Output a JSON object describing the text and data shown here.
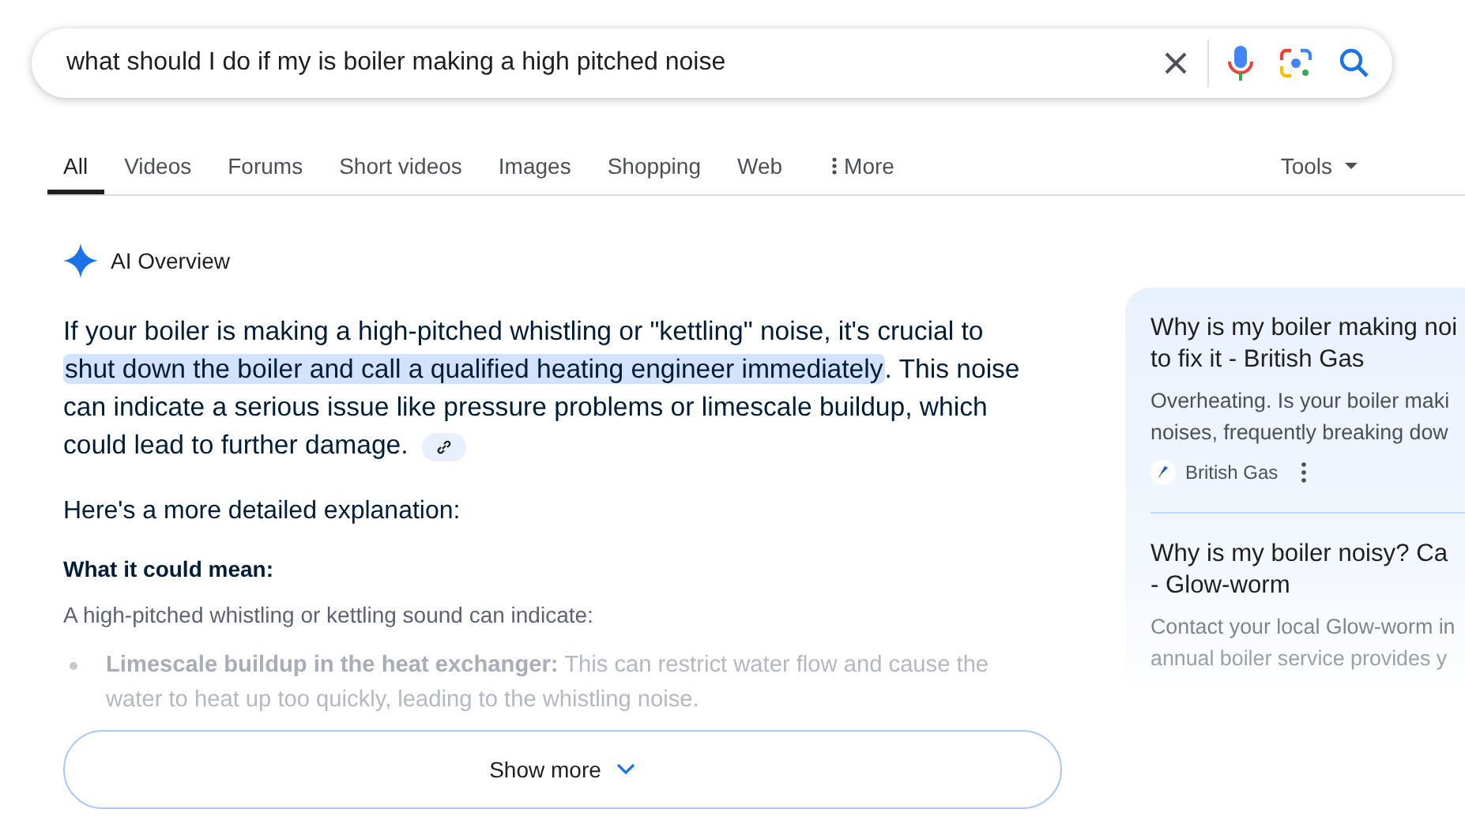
{
  "search": {
    "value": "what should I do if my is boiler making a high pitched noise"
  },
  "tabs": [
    {
      "label": "All",
      "selected": true,
      "kind": "tab"
    },
    {
      "label": "Videos",
      "selected": false,
      "kind": "tab"
    },
    {
      "label": "Forums",
      "selected": false,
      "kind": "tab"
    },
    {
      "label": "Short videos",
      "selected": false,
      "kind": "tab"
    },
    {
      "label": "Images",
      "selected": false,
      "kind": "tab"
    },
    {
      "label": "Shopping",
      "selected": false,
      "kind": "tab"
    },
    {
      "label": "Web",
      "selected": false,
      "kind": "tab"
    },
    {
      "label": "More",
      "selected": false,
      "kind": "more"
    }
  ],
  "tools": "Tools",
  "ai_overview": {
    "label": "AI Overview",
    "summary": [
      {
        "text": "If your boiler is making a high-pitched whistling or \"kettling\" noise, it's crucial to ",
        "highlighted": false
      },
      {
        "text": "shut down the boiler and call a qualified heating engineer immediately",
        "highlighted": true
      },
      {
        "text": ". This noise can indicate a serious issue like pressure problems or limescale buildup, which could lead to further damage.",
        "highlighted": false
      }
    ],
    "intro": "Here's a more detailed explanation:",
    "heading": "What it could mean:",
    "lead": "A high-pitched whistling or kettling sound can indicate:",
    "bullets": [
      "**Limescale buildup in the heat exchanger:** This can restrict water flow and cause the water to heat up too quickly, leading to the whistling noise."
    ],
    "show_more": "Show more"
  },
  "sources": [
    {
      "title_lines": [
        "Why is my boiler making noi",
        "to fix it - British Gas"
      ],
      "snippet_lines": [
        "Overheating. Is your boiler maki",
        "noises, frequently breaking dow"
      ],
      "site": "British Gas"
    },
    {
      "title_lines": [
        "Why is my boiler noisy? Ca",
        "- Glow-worm"
      ],
      "snippet_lines": [
        "Contact your local Glow-worm in",
        "annual boiler service provides y"
      ]
    }
  ]
}
